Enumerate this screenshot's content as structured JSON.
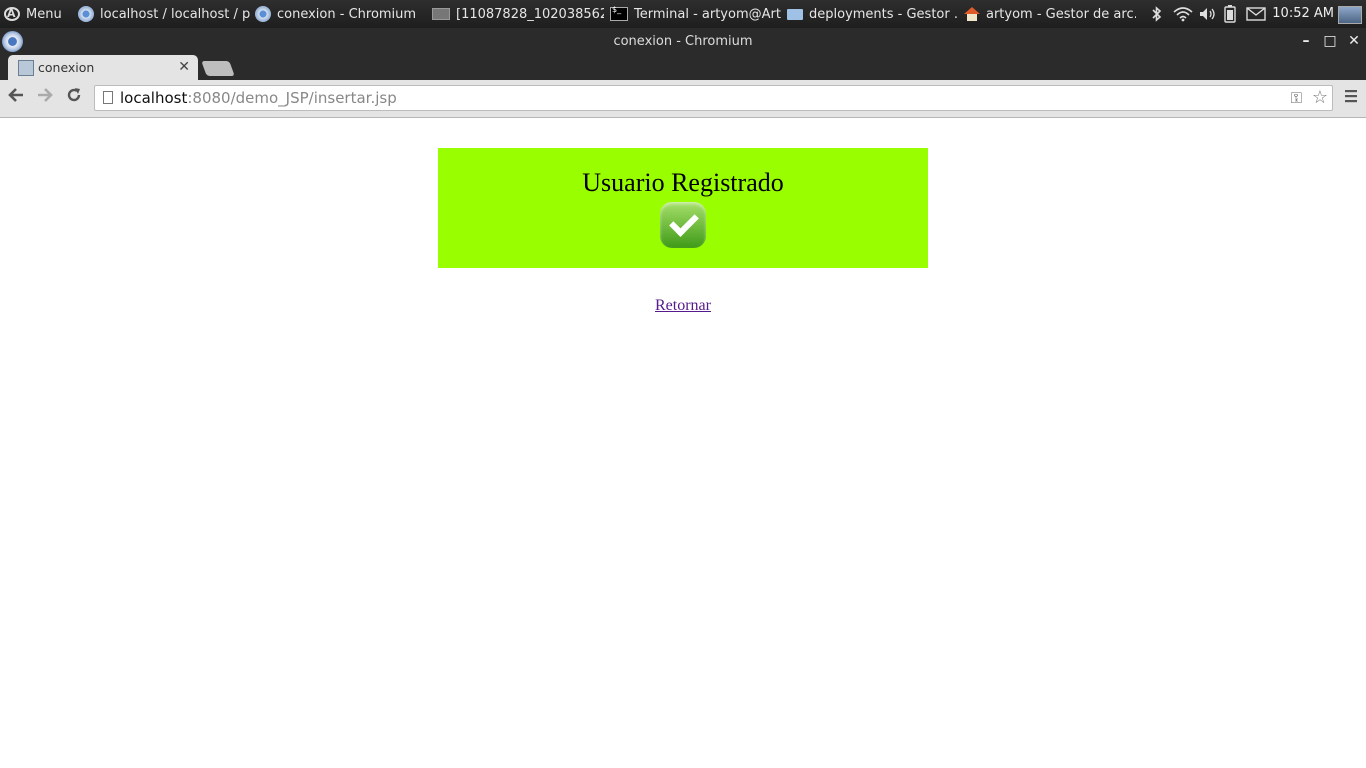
{
  "taskbar": {
    "menu_label": "Menu",
    "tasks": [
      {
        "label": "localhost / localhost / p...",
        "icon": "chromium-icon"
      },
      {
        "label": "conexion - Chromium",
        "icon": "chromium-icon"
      },
      {
        "label": "[11087828_1020385625...",
        "icon": "image-icon"
      },
      {
        "label": "Terminal - artyom@Art...",
        "icon": "terminal-icon"
      },
      {
        "label": "deployments - Gestor ...",
        "icon": "folder-icon"
      },
      {
        "label": "artyom - Gestor de arc...",
        "icon": "home-folder-icon"
      }
    ],
    "clock": "10:52 AM"
  },
  "window": {
    "title": "conexion - Chromium"
  },
  "browser": {
    "tab_title": "conexion",
    "url_host": "localhost",
    "url_rest": ":8080/demo_JSP/insertar.jsp"
  },
  "page": {
    "banner_text": "Usuario Registrado",
    "banner_color": "#99ff00",
    "return_link": "Retornar",
    "link_color": "#551a8b"
  }
}
